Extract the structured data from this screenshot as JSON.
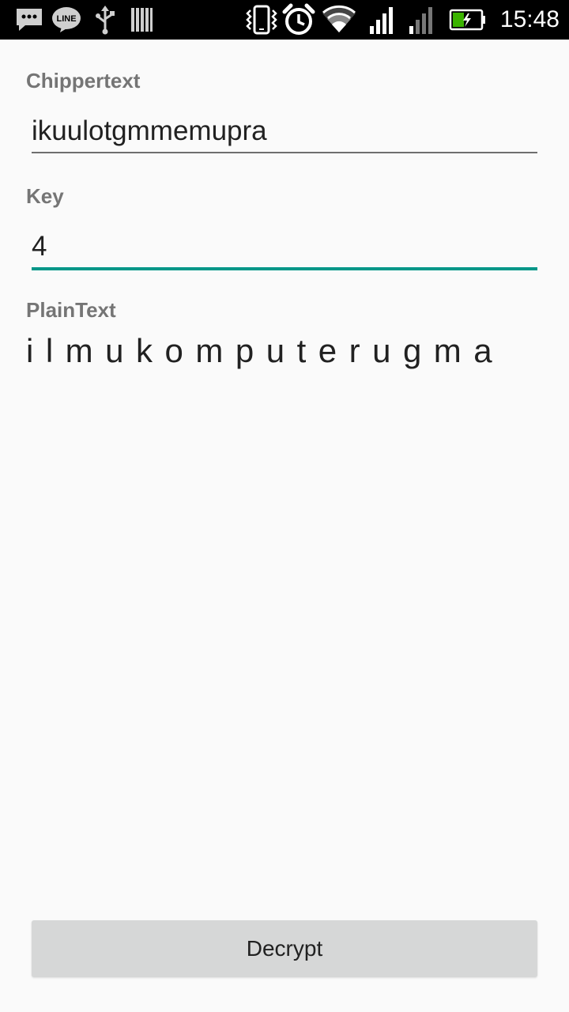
{
  "status_bar": {
    "time": "15:48",
    "icons": [
      "message-icon",
      "line-app-icon",
      "usb-icon",
      "barcode-icon",
      "vibrate-icon",
      "alarm-icon",
      "wifi-icon",
      "signal-icon",
      "signal-weak-icon",
      "battery-charging-icon"
    ],
    "line_label": "LINE"
  },
  "form": {
    "ciphertext_label": "Chippertext",
    "ciphertext_value": "ikuulotgmmemupra",
    "key_label": "Key",
    "key_value": "4",
    "plaintext_label": "PlainText",
    "plaintext_value": "ilmukomputerugma"
  },
  "actions": {
    "decrypt_label": "Decrypt"
  },
  "colors": {
    "accent": "#009688",
    "label": "#757575",
    "background": "#fafafa",
    "button": "#d6d7d7"
  }
}
